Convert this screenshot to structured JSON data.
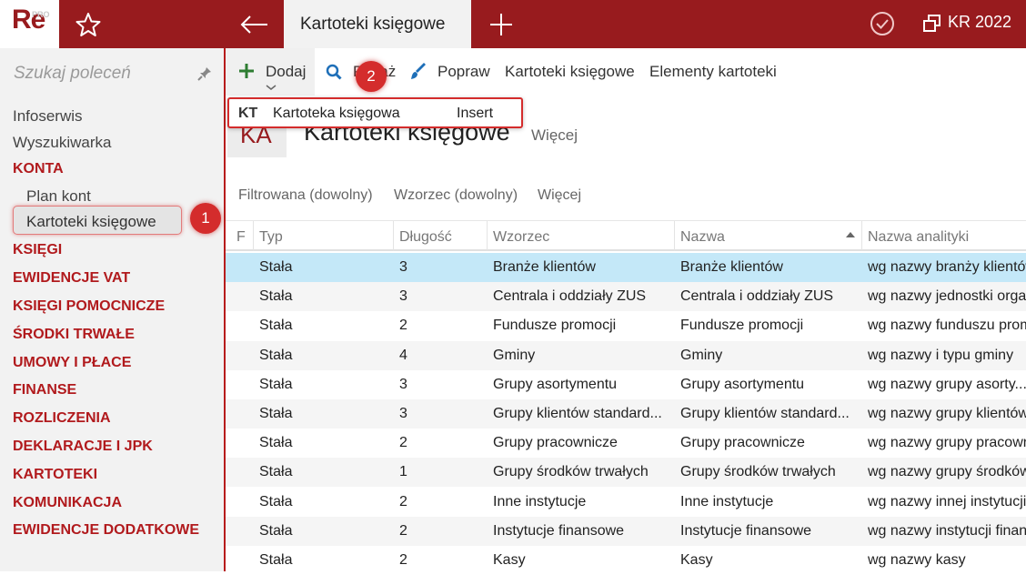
{
  "app": {
    "logo_text": "Re",
    "logo_badge": "PRO"
  },
  "topbar": {
    "active_tab": "Kartoteki księgowe",
    "company": "KR 2022"
  },
  "sidebar": {
    "search_placeholder": "Szukaj poleceń",
    "items": [
      {
        "label": "Infoserwis",
        "type": "item"
      },
      {
        "label": "Wyszukiwarka",
        "type": "item"
      },
      {
        "label": "KONTA",
        "type": "head"
      },
      {
        "label": "Plan kont",
        "type": "sub"
      },
      {
        "label": "Kartoteki księgowe",
        "type": "sub-selected"
      },
      {
        "label": "KSIĘGI",
        "type": "head"
      },
      {
        "label": "EWIDENCJE VAT",
        "type": "head"
      },
      {
        "label": "KSIĘGI POMOCNICZE",
        "type": "head"
      },
      {
        "label": "ŚRODKI TRWAŁE",
        "type": "head"
      },
      {
        "label": "UMOWY I PŁACE",
        "type": "head"
      },
      {
        "label": "FINANSE",
        "type": "head"
      },
      {
        "label": "ROZLICZENIA",
        "type": "head"
      },
      {
        "label": "DEKLARACJE I JPK",
        "type": "head"
      },
      {
        "label": "KARTOTEKI",
        "type": "head"
      },
      {
        "label": "KOMUNIKACJA",
        "type": "head"
      },
      {
        "label": "EWIDENCJE DODATKOWE",
        "type": "head"
      }
    ]
  },
  "toolbar": {
    "add": "Dodaj",
    "show": "Pokaż",
    "edit": "Popraw",
    "ledgers": "Kartoteki księgowe",
    "elements": "Elementy kartoteki"
  },
  "dropdown": {
    "code": "KT",
    "label": "Kartoteka księgowa",
    "shortcut": "Insert"
  },
  "badges": {
    "one": "1",
    "two": "2"
  },
  "page": {
    "icon_text": "KA",
    "title": "Kartoteki księgowe",
    "more": "Więcej"
  },
  "filters": {
    "filtered": "Filtrowana (dowolny)",
    "pattern": "Wzorzec (dowolny)",
    "more": "Więcej"
  },
  "table": {
    "columns": [
      "F",
      "Typ",
      "Długość",
      "Wzorzec",
      "Nazwa",
      "Nazwa analityki"
    ],
    "rows": [
      [
        "Stała",
        "3",
        "Branże klientów",
        "Branże klientów",
        "wg nazwy branży klientów"
      ],
      [
        "Stała",
        "3",
        "Centrala i oddziały ZUS",
        "Centrala i oddziały ZUS",
        "wg nazwy jednostki organizacyjnej"
      ],
      [
        "Stała",
        "2",
        "Fundusze promocji",
        "Fundusze promocji",
        "wg nazwy funduszu promocji"
      ],
      [
        "Stała",
        "4",
        "Gminy",
        "Gminy",
        "wg nazwy i typu gminy"
      ],
      [
        "Stała",
        "3",
        "Grupy asortymentu",
        "Grupy asortymentu",
        "wg nazwy grupy asorty..."
      ],
      [
        "Stała",
        "3",
        "Grupy klientów standard...",
        "Grupy klientów standard...",
        "wg nazwy grupy klientów"
      ],
      [
        "Stała",
        "2",
        "Grupy pracownicze",
        "Grupy pracownicze",
        "wg nazwy grupy pracowniczej"
      ],
      [
        "Stała",
        "1",
        "Grupy środków trwałych",
        "Grupy środków trwałych",
        "wg nazwy grupy środków"
      ],
      [
        "Stała",
        "2",
        "Inne instytucje",
        "Inne instytucje",
        "wg nazwy innej instytucji"
      ],
      [
        "Stała",
        "2",
        "Instytucje finansowe",
        "Instytucje finansowe",
        "wg nazwy instytucji finansowej"
      ],
      [
        "Stała",
        "2",
        "Kasy",
        "Kasy",
        "wg nazwy kasy"
      ]
    ]
  },
  "colors": {
    "brand": "#981b1e",
    "accent_green": "#2e7d32",
    "accent_blue": "#1e6fb8",
    "selection": "#c4e8f8"
  }
}
